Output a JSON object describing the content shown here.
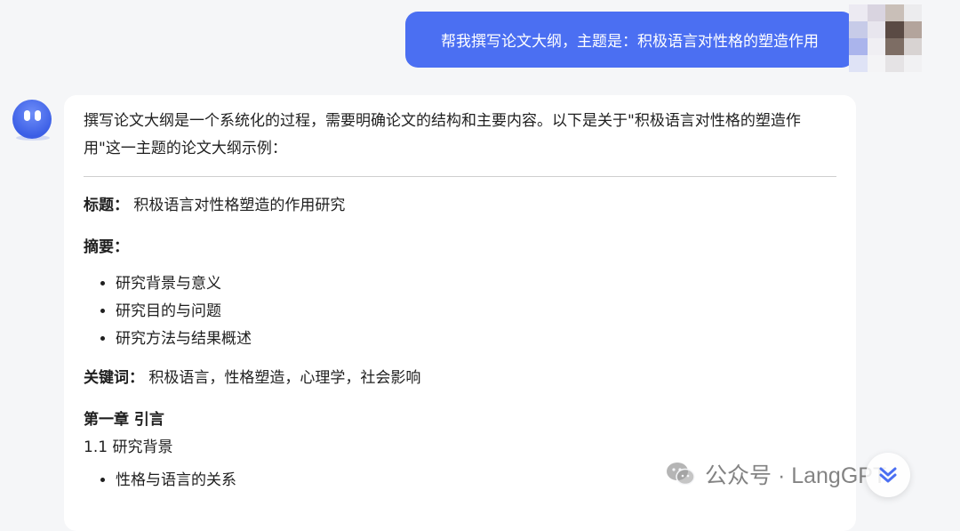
{
  "user_message": {
    "text": "帮我撰写论文大纲，主题是：积极语言对性格的塑造作用"
  },
  "assistant_message": {
    "intro": "撰写论文大纲是一个系统化的过程，需要明确论文的结构和主要内容。以下是关于\"积极语言对性格的塑造作用\"这一主题的论文大纲示例：",
    "title_label": "标题：",
    "title_value": "积极语言对性格塑造的作用研究",
    "abstract_label": "摘要：",
    "abstract_items": [
      "研究背景与意义",
      "研究目的与问题",
      "研究方法与结果概述"
    ],
    "keywords_label": "关键词：",
    "keywords_value": "积极语言，性格塑造，心理学，社会影响",
    "chapter_title": "第一章 引言",
    "section_title": "1.1 研究背景",
    "section_items": [
      "性格与语言的关系"
    ]
  },
  "watermark": {
    "text": "公众号 · LangGPT"
  },
  "colors": {
    "user_bubble": "#4b6ff2",
    "background": "#f5f6f8",
    "card": "#ffffff"
  },
  "icons": {
    "bot_avatar": "robot-face-icon",
    "scroll": "double-chevron-down-icon",
    "watermark": "wechat-icon"
  }
}
